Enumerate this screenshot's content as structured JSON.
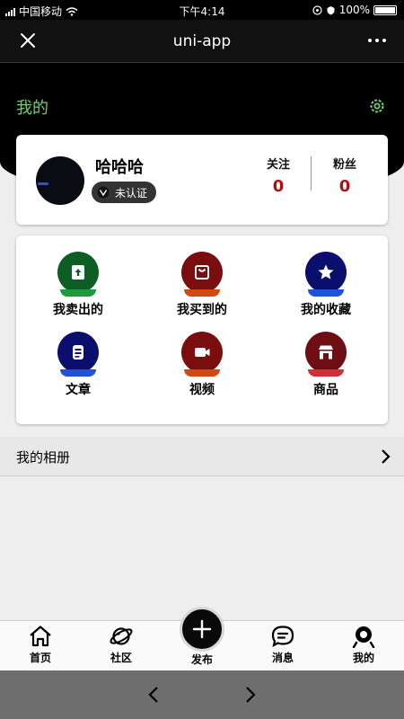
{
  "status_bar": {
    "carrier": "中国移动",
    "time": "下午4:14",
    "battery": "100%"
  },
  "nav": {
    "title": "uni-app",
    "icons": {
      "close": "close-icon",
      "more": "more-icon"
    }
  },
  "page": {
    "title": "我的",
    "settings_icon": "gear-icon",
    "accent_color": "#6fcf6f"
  },
  "profile": {
    "name": "哈哈哈",
    "badge": "未认证",
    "stats": [
      {
        "label": "关注",
        "value": "0"
      },
      {
        "label": "粉丝",
        "value": "0"
      }
    ]
  },
  "grid": [
    {
      "label": "我卖出的",
      "icon": "sold-icon",
      "color": "#0d5e24",
      "under": "#1f9a3a"
    },
    {
      "label": "我买到的",
      "icon": "bag-icon",
      "color": "#7a0d0d",
      "under": "#d04a10"
    },
    {
      "label": "我的收藏",
      "icon": "star-icon",
      "color": "#0a0f6e",
      "under": "#1d52d9"
    },
    {
      "label": "文章",
      "icon": "article-icon",
      "color": "#0a0f6e",
      "under": "#1d52d9"
    },
    {
      "label": "视频",
      "icon": "video-icon",
      "color": "#7a0d0d",
      "under": "#d04a10"
    },
    {
      "label": "商品",
      "icon": "store-icon",
      "color": "#6e0d14",
      "under": "#d0303a"
    }
  ],
  "album": {
    "label": "我的相册"
  },
  "tabbar": [
    {
      "label": "首页",
      "icon": "home-icon"
    },
    {
      "label": "社区",
      "icon": "planet-icon"
    },
    {
      "label": "发布",
      "icon": "plus-icon"
    },
    {
      "label": "消息",
      "icon": "message-icon"
    },
    {
      "label": "我的",
      "icon": "profile-icon"
    }
  ]
}
